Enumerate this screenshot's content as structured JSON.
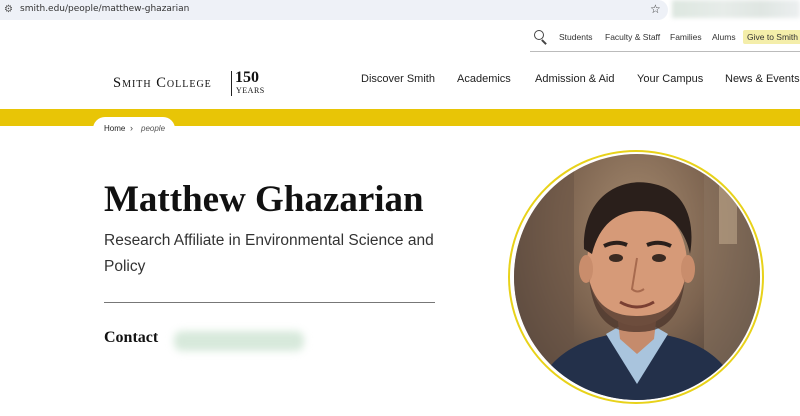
{
  "browser": {
    "url": "smith.edu/people/matthew-ghazarian"
  },
  "utility_nav": {
    "items": [
      "Students",
      "Faculty & Staff",
      "Families",
      "Alums"
    ],
    "give_label": "Give to Smith"
  },
  "logo": {
    "wordmark": "Smith College",
    "anniversary_number": "150",
    "anniversary_word": "YEARS"
  },
  "main_nav": {
    "items": [
      "Discover Smith",
      "Academics",
      "Admission & Aid",
      "Your Campus",
      "News & Events"
    ]
  },
  "breadcrumb": {
    "home": "Home",
    "separator": "›",
    "current": "people"
  },
  "profile": {
    "name": "Matthew Ghazarian",
    "title": "Research Affiliate in Environmental Science and Policy",
    "contact_heading": "Contact"
  },
  "colors": {
    "brand_yellow": "#e8c506",
    "give_highlight": "#f4eeaa"
  }
}
